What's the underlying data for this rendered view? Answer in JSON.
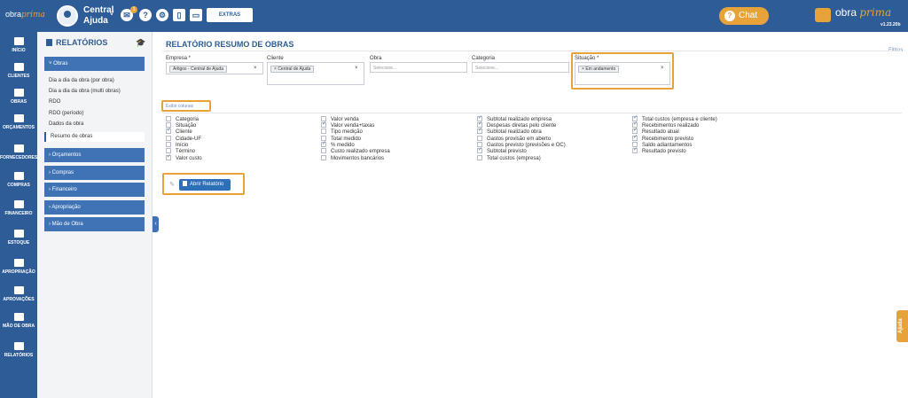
{
  "topbar": {
    "logo": "obra",
    "logo_accent": "prima",
    "user_line1": "Central",
    "user_line2": "Ajuda",
    "notification_count": "1",
    "extras_label": "EXTRAS",
    "chat_label": "Chat",
    "brand": "obra",
    "brand_accent": "prima",
    "version": "v1.23.20b",
    "icons": [
      "bell-icon",
      "help-icon",
      "settings-icon",
      "tablet-icon",
      "monitor-icon"
    ]
  },
  "leftnav": {
    "items": [
      {
        "label": "INÍCIO",
        "icon": "home-icon"
      },
      {
        "label": "CLIENTES",
        "icon": "person-icon"
      },
      {
        "label": "OBRAS",
        "icon": "building-icon"
      },
      {
        "label": "ORÇAMENTOS",
        "icon": "document-icon"
      },
      {
        "label": "FORNECEDORES",
        "icon": "truck-icon"
      },
      {
        "label": "COMPRAS",
        "icon": "cart-icon"
      },
      {
        "label": "FINANCEIRO",
        "icon": "calculator-icon"
      },
      {
        "label": "ESTOQUE",
        "icon": "boxes-icon"
      },
      {
        "label": "APROPRIAÇÃO",
        "icon": "file-icon"
      },
      {
        "label": "APROVAÇÕES",
        "icon": "list-check-icon"
      },
      {
        "label": "MÃO DE OBRA",
        "icon": "workers-icon"
      },
      {
        "label": "RELATÓRIOS",
        "icon": "report-icon"
      }
    ]
  },
  "sidepanel": {
    "title": "RELATÓRIOS",
    "groups": {
      "obras": "˅ Obras",
      "orcamentos": "› Orçamentos",
      "compras": "› Compras",
      "financeiro": "› Financeiro",
      "apropriacao": "› Apropriação",
      "mao_de_obra": "› Mão de Obra"
    },
    "obras_items": [
      "Dia a dia da obra (por obra)",
      "Dia a dia da obra (multi obras)",
      "RDO",
      "RDO (período)",
      "Dados da obra",
      "Resumo de obras"
    ]
  },
  "main": {
    "title": "RELATÓRIO RESUMO DE OBRAS",
    "filtros_label": "Filtros",
    "filters": {
      "empresa": {
        "label": "Empresa *",
        "value": "Artigos - Central de Ajuda"
      },
      "cliente": {
        "label": "Cliente",
        "value": "Central de Ajuda"
      },
      "obra": {
        "label": "Obra",
        "placeholder": "Selecione..."
      },
      "categoria": {
        "label": "Categoria",
        "placeholder": "Selecione..."
      },
      "situacao": {
        "label": "Situação *",
        "value": "Em andamento"
      }
    },
    "exibir_colunas": "Exibir colunas",
    "columns": {
      "col1": [
        {
          "label": "Categoria",
          "checked": false
        },
        {
          "label": "Situação",
          "checked": false
        },
        {
          "label": "Cliente",
          "checked": true
        },
        {
          "label": "Cidade-UF",
          "checked": false
        },
        {
          "label": "Início",
          "checked": false
        },
        {
          "label": "Término",
          "checked": false
        },
        {
          "label": "Valor custo",
          "checked": true
        }
      ],
      "col2": [
        {
          "label": "Valor venda",
          "checked": false
        },
        {
          "label": "Valor venda+taxas",
          "checked": true
        },
        {
          "label": "Tipo medição",
          "checked": false
        },
        {
          "label": "Total medido",
          "checked": false
        },
        {
          "label": "% medido",
          "checked": true
        },
        {
          "label": "Custo realizado empresa",
          "checked": false
        },
        {
          "label": "Movimentos bancários",
          "checked": false
        }
      ],
      "col3": [
        {
          "label": "Subtotal realizado empresa",
          "checked": true
        },
        {
          "label": "Despesas diretas pelo cliente",
          "checked": true
        },
        {
          "label": "Subtotal realizado obra",
          "checked": true
        },
        {
          "label": "Gastos provisão em aberto",
          "checked": false
        },
        {
          "label": "Gastos previsto (previsões e OC)",
          "checked": false
        },
        {
          "label": "Subtotal previsto",
          "checked": true
        },
        {
          "label": "Total custos (empresa)",
          "checked": false
        }
      ],
      "col4": [
        {
          "label": "Total custos (empresa e cliente)",
          "checked": true
        },
        {
          "label": "Recebimentos realizado",
          "checked": true
        },
        {
          "label": "Resultado atual",
          "checked": true
        },
        {
          "label": "Recebimento previsto",
          "checked": true
        },
        {
          "label": "Saldo adiantamentos",
          "checked": false
        },
        {
          "label": "Resultado previsto",
          "checked": true
        }
      ]
    },
    "open_button": "Abrir Relatório"
  },
  "ajuda_label": "Ajuda",
  "colors": {
    "primary": "#2d5c96",
    "accent": "#e8a23a",
    "button": "#2d6fb8"
  }
}
